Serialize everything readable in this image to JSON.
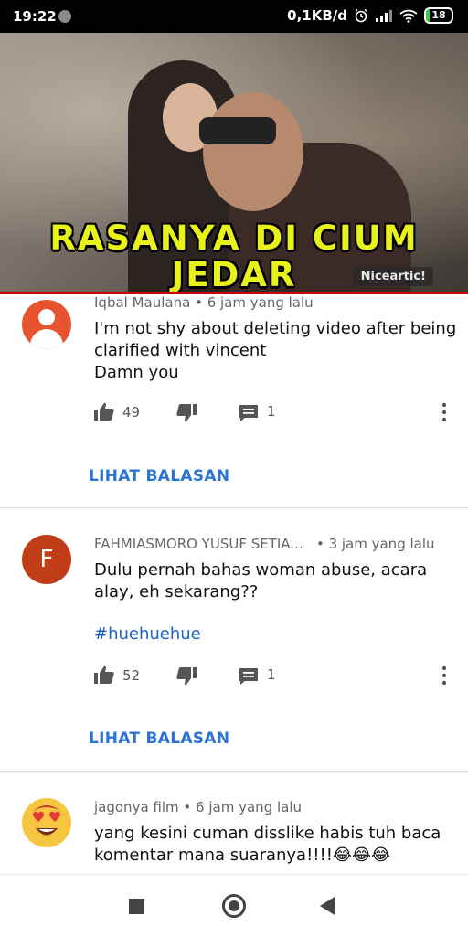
{
  "status_bar": {
    "time": "19:22",
    "network_speed": "0,1KB/d",
    "battery_level": "18",
    "icons": [
      "alarm-icon",
      "signal-icon",
      "wifi-icon",
      "battery-icon"
    ]
  },
  "video": {
    "title_line1": "RASANYA DI CIUM",
    "title_line2": "JEDAR",
    "watermark": "Niceartic!"
  },
  "comments": [
    {
      "author": "Iqbal Maulana",
      "time": "6 jam yang lalu",
      "text_lines": [
        "I'm not shy about deleting video after being",
        "clarified with vincent",
        "Damn you"
      ],
      "likes": "49",
      "replies_count": "1",
      "view_replies": "LIHAT BALASAN",
      "avatar": "default-avatar-icon"
    },
    {
      "author": "FAHMIASMORO YUSUF SETIA...",
      "time": "3 jam yang lalu",
      "avatar_letter": "F",
      "text_lines": [
        "Dulu pernah bahas woman abuse, acara",
        "alay, eh sekarang??"
      ],
      "hashtag": "#huehuehue",
      "likes": "52",
      "replies_count": "1",
      "view_replies": "LIHAT BALASAN"
    },
    {
      "author": "jagonya film",
      "time": "6 jam yang lalu",
      "text_lines": [
        "yang kesini cuman disslike habis tuh baca",
        "komentar mana suaranya!!!!😂😂😂"
      ],
      "avatar": "heart-eyes-emoji-avatar"
    }
  ],
  "colors": {
    "accent_blue": "#2b74d6",
    "hashtag_blue": "#1b64c7",
    "avatar_orange": "#e8542f",
    "avatar_letter_bg": "#c13d18",
    "title_yellow": "#e8f21a",
    "progress_red": "#cc0000"
  },
  "nav_bar": {
    "icons": [
      "recent-apps-icon",
      "home-icon",
      "back-icon"
    ]
  }
}
